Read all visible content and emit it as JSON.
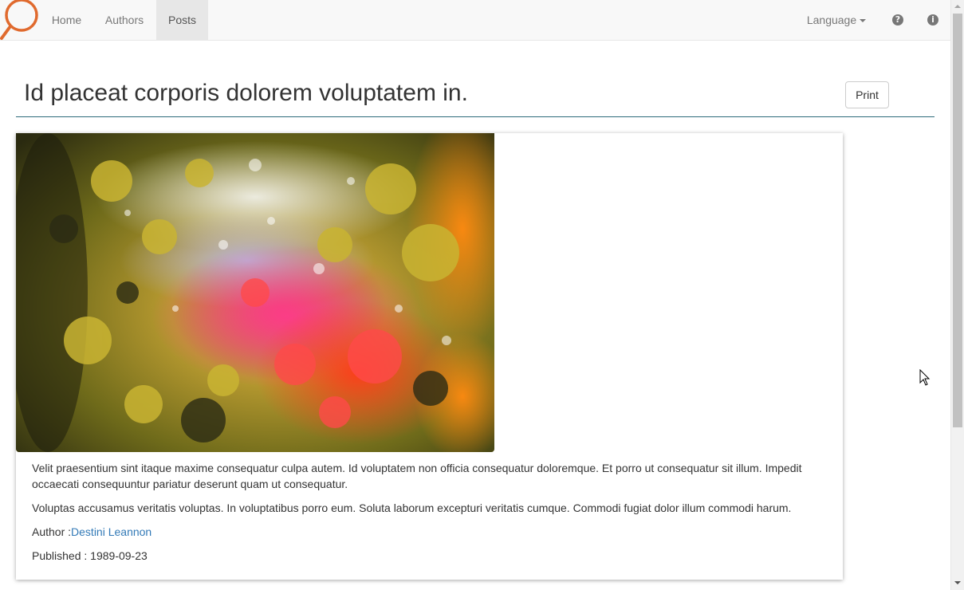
{
  "navbar": {
    "brand_icon": "magnifier-logo",
    "items": [
      {
        "label": "Home"
      },
      {
        "label": "Authors"
      },
      {
        "label": "Posts",
        "active": true
      }
    ],
    "language_label": "Language",
    "help_icon": "question-circle-icon",
    "info_icon": "info-circle-icon"
  },
  "post": {
    "title": "Id placeat corporis dolorem voluptatem in.",
    "print_label": "Print",
    "image_alt": "oil-bubbles-photo",
    "paragraphs": [
      "Velit praesentium sint itaque maxime consequatur culpa autem. Id voluptatem non officia consequatur doloremque. Et porro ut consequatur sit illum. Impedit occaecati consequuntur pariatur deserunt quam ut consequatur.",
      "Voluptas accusamus veritatis voluptas. In voluptatibus porro eum. Soluta laborum excepturi veritatis cumque. Commodi fugiat dolor illum commodi harum."
    ],
    "author_label": "Author :",
    "author_name": "Destini Leannon",
    "published_label": "Published : ",
    "published_date": "1989-09-23"
  },
  "colors": {
    "navbar_bg": "#f8f8f8",
    "active_nav_bg": "#e7e7e7",
    "brand_orange": "#e06a2e",
    "link": "#337ab7",
    "header_rule": "#2d6a7a"
  }
}
